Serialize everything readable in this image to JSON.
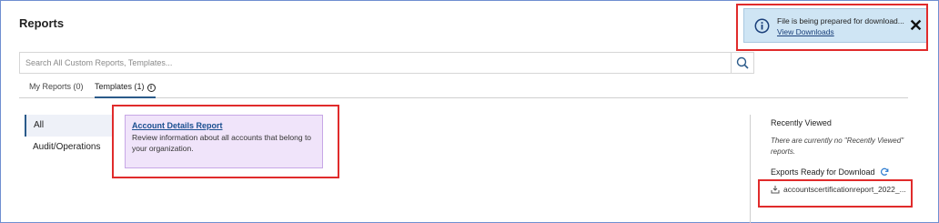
{
  "page": {
    "title": "Reports"
  },
  "search": {
    "placeholder": "Search All Custom Reports, Templates..."
  },
  "tabs": [
    {
      "label": "My Reports (0)"
    },
    {
      "label": "Templates (1)"
    }
  ],
  "left_nav": [
    {
      "label": "All"
    },
    {
      "label": "Audit/Operations"
    }
  ],
  "card": {
    "title": "Account Details Report",
    "description": "Review information about all accounts that belong to your organization."
  },
  "right_panel": {
    "recent_heading": "Recently Viewed",
    "recent_empty": "There are currently no \"Recently Viewed\" reports.",
    "exports_heading": "Exports Ready for Download",
    "export_file": "accountscertificationreport_2022_..."
  },
  "toast": {
    "message": "File is being prepared for download...",
    "link": "View Downloads"
  },
  "colors": {
    "accent": "#2a5a8a",
    "card_bg": "#f0e4fa",
    "toast_bg": "#cfe5f4",
    "highlight": "#e02b2b"
  }
}
